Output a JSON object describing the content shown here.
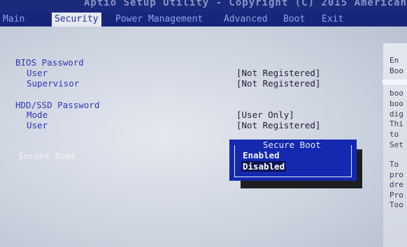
{
  "title_bar": {
    "text": "Aptio Setup Utility - Copyright (C) 2015 American"
  },
  "menu": {
    "items": [
      {
        "label": "Main"
      },
      {
        "label": "Security",
        "active": true
      },
      {
        "label": "Power Management"
      },
      {
        "label": "Advanced"
      },
      {
        "label": "Boot"
      },
      {
        "label": "Exit"
      }
    ]
  },
  "security": {
    "bios_password": {
      "heading": "BIOS Password",
      "user_label": "User",
      "user_value": "[Not Registered]",
      "supervisor_label": "Supervisor",
      "supervisor_value": "[Not Registered]"
    },
    "hdd_password": {
      "heading": "HDD/SSD Password",
      "mode_label": "Mode",
      "mode_value": "[User Only]",
      "user_label": "User",
      "user_value": "[Not Registered]"
    },
    "secure_boot": {
      "label": "Secure Boot"
    }
  },
  "popup": {
    "title": "Secure Boot",
    "options": [
      {
        "label": "Enabled",
        "selected": false
      },
      {
        "label": "Disabled",
        "selected": true
      }
    ]
  },
  "help_panel": {
    "lines": [
      "En",
      "Boo",
      "",
      "boo",
      "boo",
      "dig",
      "Thi",
      "to",
      "Set",
      "",
      "To",
      "pro",
      "dre",
      "Pro",
      "Too"
    ]
  },
  "colors": {
    "menu_bar": "#17267a",
    "label_blue": "#2d39b8",
    "popup_bg": "#1428b0"
  }
}
